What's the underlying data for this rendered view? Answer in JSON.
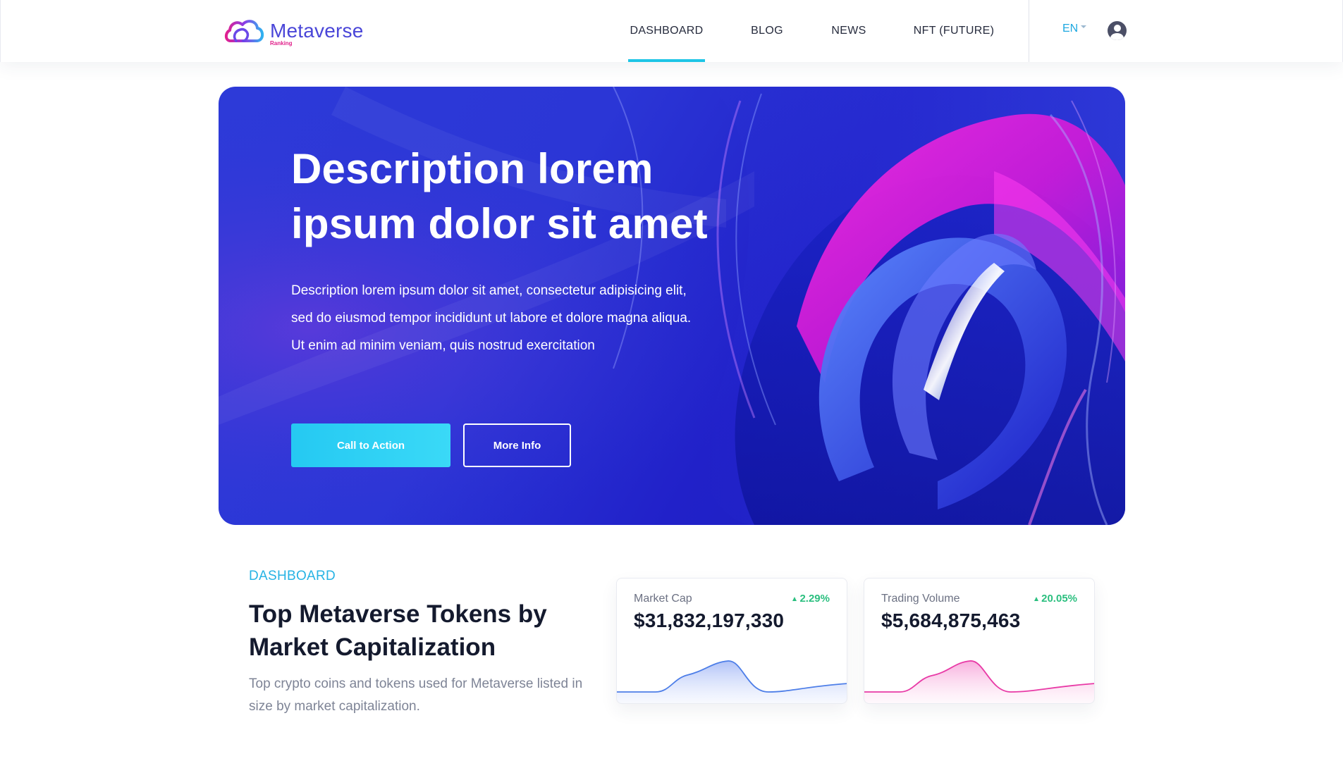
{
  "brand": {
    "name": "Metaverse",
    "sub": "Ranking"
  },
  "nav": {
    "items": [
      {
        "label": "DASHBOARD",
        "active": true
      },
      {
        "label": "BLOG",
        "active": false
      },
      {
        "label": "NEWS",
        "active": false
      },
      {
        "label": "NFT (FUTURE)",
        "active": false
      }
    ],
    "language": "EN"
  },
  "hero": {
    "title": "Description lorem ipsum dolor sit amet",
    "description": "Description lorem ipsum dolor sit amet, consectetur adipisicing elit, sed do eiusmod tempor incididunt ut labore et dolore magna aliqua. Ut enim ad minim veniam, quis nostrud exercitation",
    "primary_button": "Call to Action",
    "secondary_button": "More Info"
  },
  "dashboard": {
    "eyebrow": "DASHBOARD",
    "title": "Top Metaverse Tokens by Market Capitalization",
    "description": "Top crypto coins and tokens used for Metaverse listed in size by market capitalization.",
    "cards": [
      {
        "label": "Market Cap",
        "change": "2.29%",
        "trend": "up",
        "value": "$31,832,197,330",
        "color": "#4d7ee8"
      },
      {
        "label": "Trading Volume",
        "change": "20.05%",
        "trend": "up",
        "value": "$5,684,875,463",
        "color": "#e83aa6"
      }
    ]
  },
  "colors": {
    "accent": "#1ec5e6",
    "brand": "#4a46d8",
    "positive": "#2bbf7f",
    "hero_bg": "#2b36d6"
  }
}
